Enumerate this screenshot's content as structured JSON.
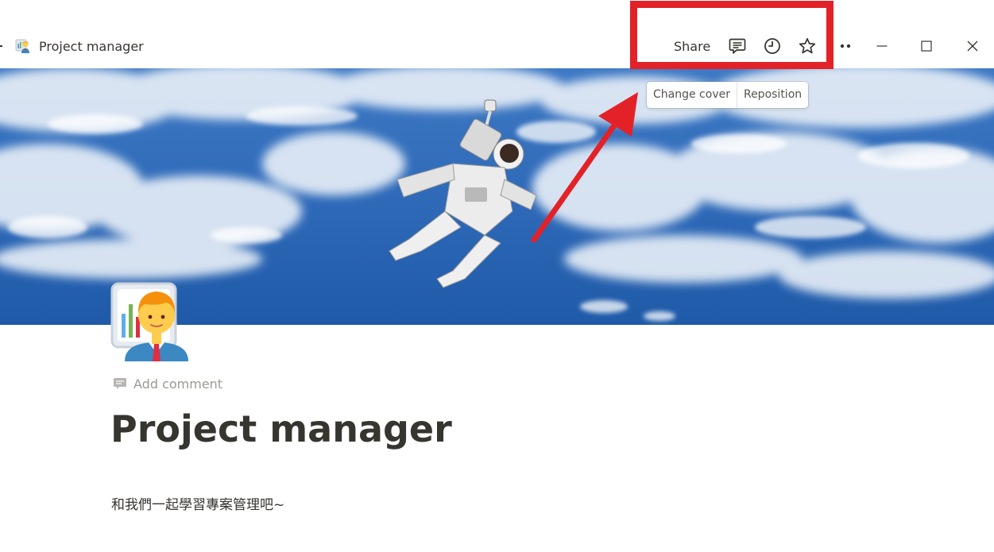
{
  "topbar": {
    "breadcrumb": {
      "title": "Project manager",
      "icon": "project-manager-emoji-icon"
    },
    "actions": {
      "share_label": "Share",
      "comment_icon": "comment-icon",
      "history_icon": "clock-icon",
      "favorite_icon": "star-icon",
      "more_icon": "more-dots-icon"
    },
    "window_controls": {
      "minimize_icon": "minimize-icon",
      "maximize_icon": "maximize-icon",
      "close_icon": "close-icon"
    }
  },
  "cover": {
    "image": "astronaut-over-earth-cover",
    "change_cover_label": "Change cover",
    "reposition_label": "Reposition"
  },
  "page": {
    "icon": "project-manager-emoji-icon",
    "add_comment_label": "Add comment",
    "title": "Project manager",
    "body_text": "和我們一起學習專案管理吧~"
  },
  "annotation": {
    "highlight_color": "#e32228",
    "arrow_color": "#e32228"
  },
  "colors": {
    "text": "#37352f",
    "muted_text": "#9b9a97",
    "background": "#ffffff"
  }
}
